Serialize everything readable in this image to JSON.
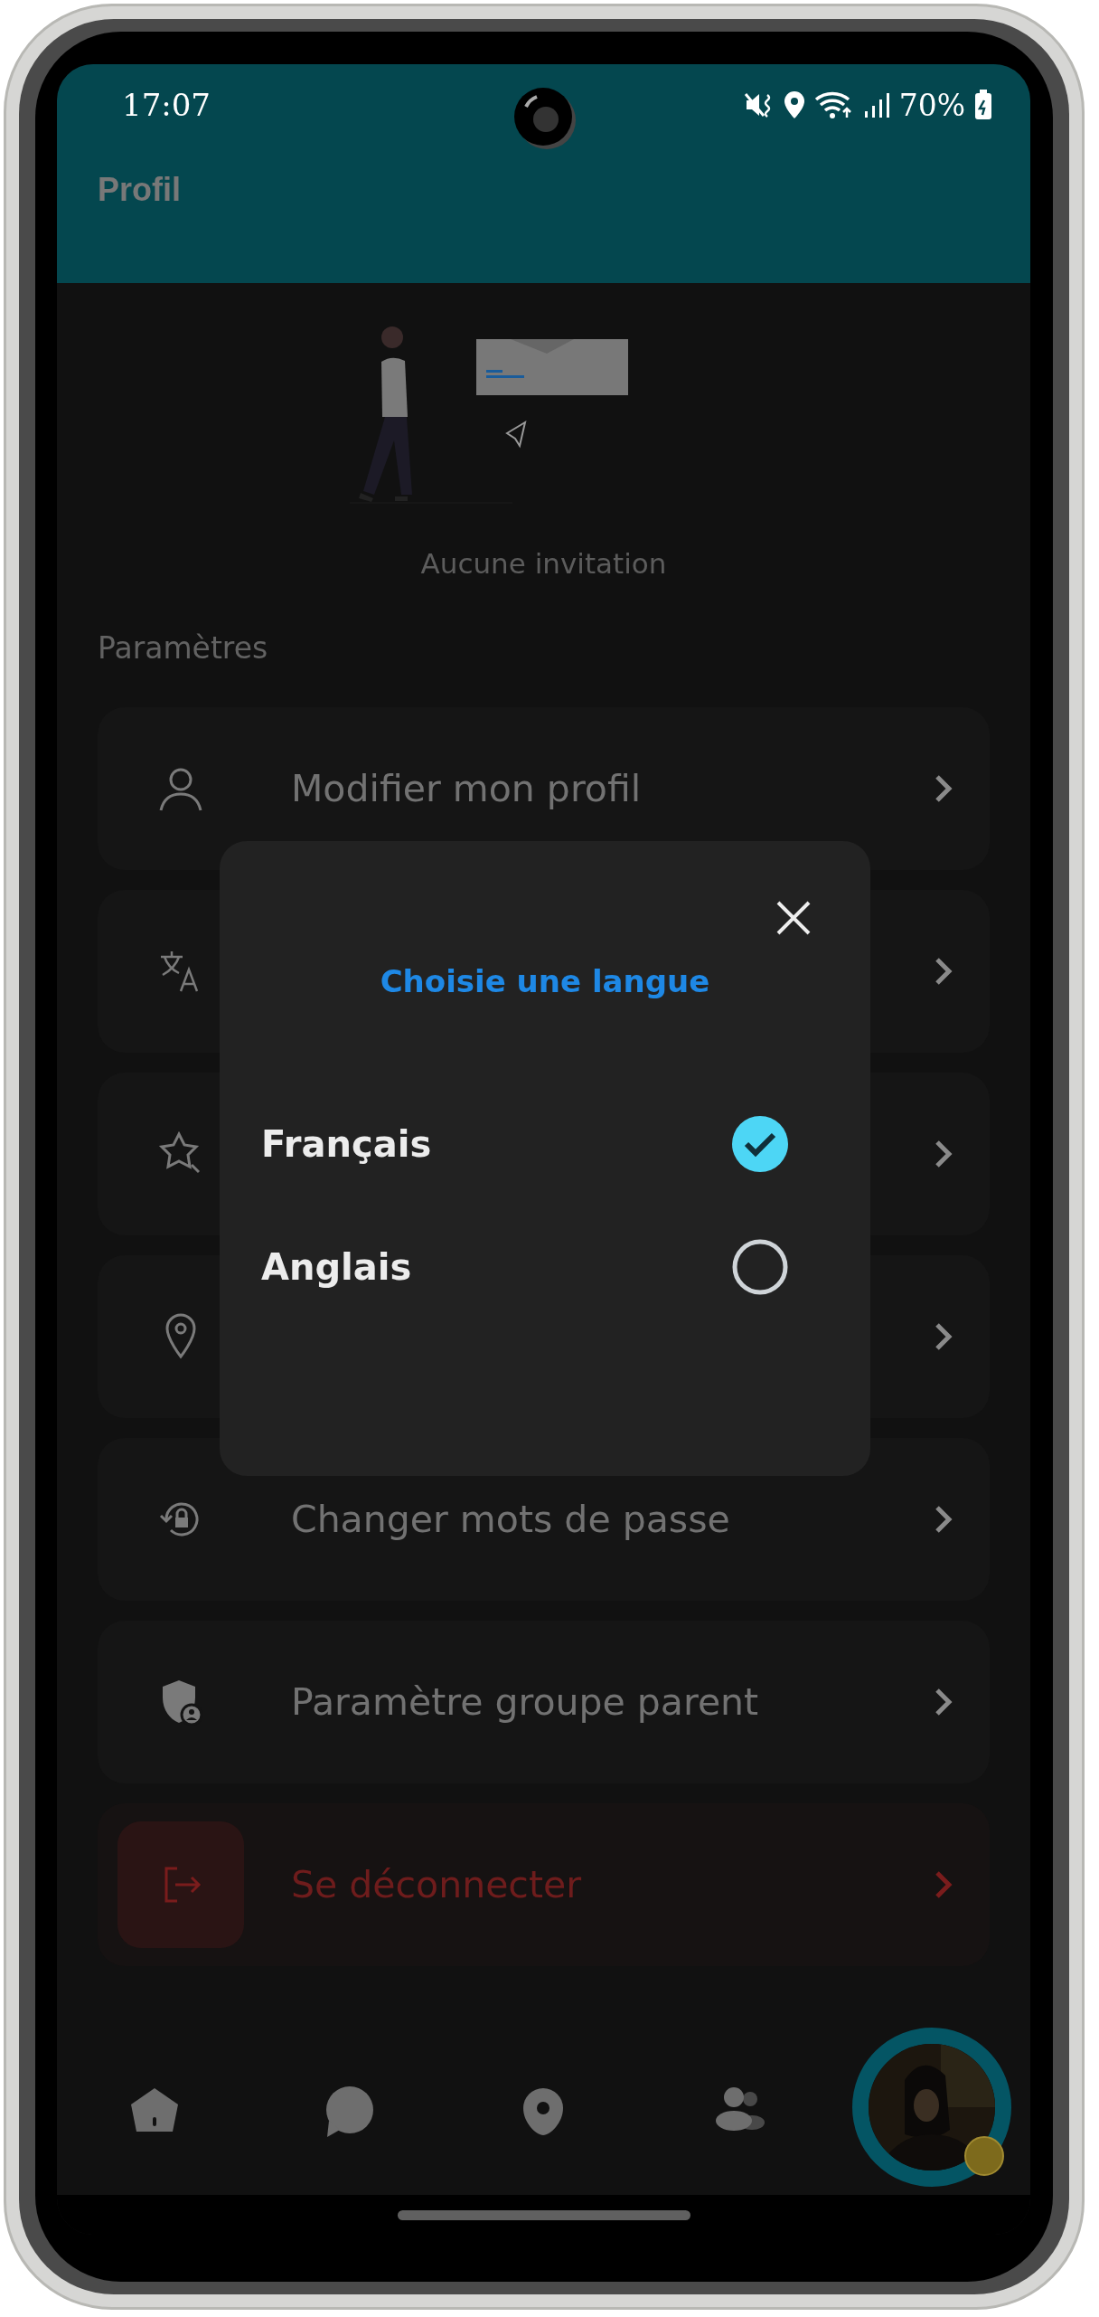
{
  "status_bar": {
    "time": "17:07",
    "battery": "70%"
  },
  "header": {
    "title": "Profil"
  },
  "empty_state": {
    "text": "Aucune invitation"
  },
  "settings": {
    "title": "Paramètres",
    "items": [
      {
        "label": "Modifier mon profil",
        "danger": false
      },
      {
        "danger": false
      },
      {
        "danger": false
      },
      {
        "danger": false
      },
      {
        "label": "Changer mots de passe",
        "danger": false
      },
      {
        "label": "Paramètre groupe parent",
        "danger": false
      },
      {
        "label": "Se déconnecter",
        "danger": true
      }
    ]
  },
  "dialog": {
    "title": "Choisie une langue",
    "options": [
      {
        "label": "Français",
        "selected": true
      },
      {
        "label": "Anglais",
        "selected": false
      }
    ]
  },
  "bottom_nav": {
    "items": [
      {
        "selected": false
      },
      {
        "selected": false
      },
      {
        "selected": false
      },
      {
        "selected": false
      },
      {
        "kind": "avatar",
        "selected": true
      }
    ]
  }
}
